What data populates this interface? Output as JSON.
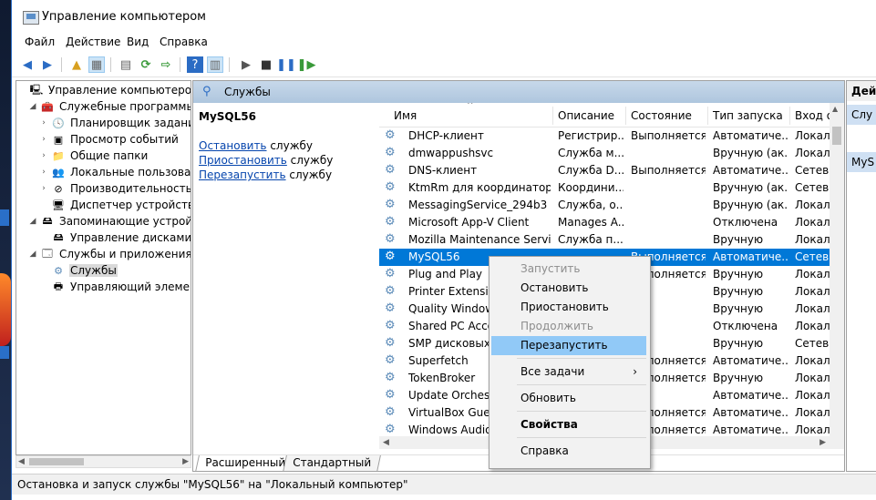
{
  "window": {
    "title": "Управление компьютером"
  },
  "menu": [
    "Файл",
    "Действие",
    "Вид",
    "Справка"
  ],
  "tree": [
    {
      "label": "Управление компьютером (л",
      "icon": "computer-management-icon",
      "arrow": "",
      "level": 0
    },
    {
      "label": "Служебные программы",
      "icon": "tools-icon",
      "arrow": "expanded",
      "level": 1
    },
    {
      "label": "Планировщик заданий",
      "icon": "clock-icon",
      "arrow": "collapsed",
      "level": 2
    },
    {
      "label": "Просмотр событий",
      "icon": "event-viewer-icon",
      "arrow": "collapsed",
      "level": 2
    },
    {
      "label": "Общие папки",
      "icon": "shared-folder-icon",
      "arrow": "collapsed",
      "level": 2
    },
    {
      "label": "Локальные пользовате",
      "icon": "users-icon",
      "arrow": "collapsed",
      "level": 2
    },
    {
      "label": "Производительность",
      "icon": "performance-icon",
      "arrow": "collapsed",
      "level": 2
    },
    {
      "label": "Диспетчер устройств",
      "icon": "device-manager-icon",
      "arrow": "",
      "level": 2
    },
    {
      "label": "Запоминающие устройст",
      "icon": "storage-icon",
      "arrow": "expanded",
      "level": 1
    },
    {
      "label": "Управление дисками",
      "icon": "disk-icon",
      "arrow": "",
      "level": 2
    },
    {
      "label": "Службы и приложения",
      "icon": "services-apps-icon",
      "arrow": "expanded",
      "level": 1
    },
    {
      "label": "Службы",
      "icon": "services-icon",
      "arrow": "",
      "level": 2,
      "selected": true
    },
    {
      "label": "Управляющий элемен",
      "icon": "wmi-icon",
      "arrow": "",
      "level": 2
    }
  ],
  "services_panel": {
    "header": "Службы",
    "selected_service": "MySQL56",
    "actions": [
      {
        "link": "Остановить",
        "suffix": " службу"
      },
      {
        "link": "Приостановить",
        "suffix": " службу"
      },
      {
        "link": "Перезапустить",
        "suffix": " службу"
      }
    ],
    "columns": [
      "Имя",
      "Описание",
      "Состояние",
      "Тип запуска",
      "Вход о"
    ],
    "rows": [
      {
        "name": "DHCP-клиент",
        "desc": "Регистрир...",
        "state": "Выполняется",
        "startup": "Автоматиче...",
        "logon": "Локаль"
      },
      {
        "name": "dmwappushsvc",
        "desc": "Служба м...",
        "state": "",
        "startup": "Вручную (ак...",
        "logon": "Локаль"
      },
      {
        "name": "DNS-клиент",
        "desc": "Служба D...",
        "state": "Выполняется",
        "startup": "Автоматиче...",
        "logon": "Сетева"
      },
      {
        "name": "KtmRm для координатора ...",
        "desc": "Координи...",
        "state": "",
        "startup": "Вручную (ак...",
        "logon": "Сетева"
      },
      {
        "name": "MessagingService_294b3",
        "desc": "Служба, о...",
        "state": "",
        "startup": "Вручную (ак...",
        "logon": "Локаль"
      },
      {
        "name": "Microsoft App-V Client",
        "desc": "Manages A...",
        "state": "",
        "startup": "Отключена",
        "logon": "Локаль"
      },
      {
        "name": "Mozilla Maintenance Service",
        "desc": "Служба п...",
        "state": "",
        "startup": "Вручную",
        "logon": "Локаль"
      },
      {
        "name": "MySQL56",
        "desc": "",
        "state": "Выполняется",
        "startup": "Автоматиче...",
        "logon": "Сетева",
        "selected": true
      },
      {
        "name": "Plug and Play",
        "desc": "",
        "state": "Выполняется",
        "startup": "Вручную",
        "logon": "Локаль"
      },
      {
        "name": "Printer Extensions",
        "desc": "",
        "state": "",
        "startup": "Вручную",
        "logon": "Локаль"
      },
      {
        "name": "Quality Windows",
        "desc": "",
        "state": "",
        "startup": "Вручную",
        "logon": "Локаль"
      },
      {
        "name": "Shared PC Accou",
        "desc": "",
        "state": "",
        "startup": "Отключена",
        "logon": "Локаль"
      },
      {
        "name": "SMP дисковых пр",
        "desc": "",
        "state": "",
        "startup": "Вручную",
        "logon": "Сетева"
      },
      {
        "name": "Superfetch",
        "desc": "",
        "state": "Выполняется",
        "startup": "Автоматиче...",
        "logon": "Локаль"
      },
      {
        "name": "TokenBroker",
        "desc": "",
        "state": "Выполняется",
        "startup": "Вручную",
        "logon": "Локаль"
      },
      {
        "name": "Update Orchestra",
        "desc": "",
        "state": "",
        "startup": "Автоматиче...",
        "logon": "Локаль"
      },
      {
        "name": "VirtualBox Guest A",
        "desc": "",
        "state": "Выполняется",
        "startup": "Автоматиче...",
        "logon": "Локаль"
      },
      {
        "name": "Windows Audio",
        "desc": "",
        "state": "Выполняется",
        "startup": "Автоматиче...",
        "logon": "Локаль"
      }
    ],
    "tabs": [
      "Расширенный",
      "Стандартный"
    ]
  },
  "actions_panel": {
    "header": "Дейс",
    "row1": "Слу",
    "row2": "MyS"
  },
  "context_menu": [
    {
      "label": "Запустить",
      "disabled": true
    },
    {
      "label": "Остановить"
    },
    {
      "label": "Приостановить"
    },
    {
      "label": "Продолжить",
      "disabled": true
    },
    {
      "label": "Перезапустить",
      "highlighted": true
    },
    {
      "separator": true
    },
    {
      "label": "Все задачи",
      "submenu": true
    },
    {
      "separator": true
    },
    {
      "label": "Обновить"
    },
    {
      "separator": true
    },
    {
      "label": "Свойства",
      "bold": true
    },
    {
      "separator": true
    },
    {
      "label": "Справка"
    }
  ],
  "status_bar": "Остановка и запуск службы \"MySQL56\" на \"Локальный компьютер\"",
  "colors": {
    "selection": "#0078d7",
    "menu_highlight": "#91c9f7",
    "header_band": "#aec6de"
  }
}
